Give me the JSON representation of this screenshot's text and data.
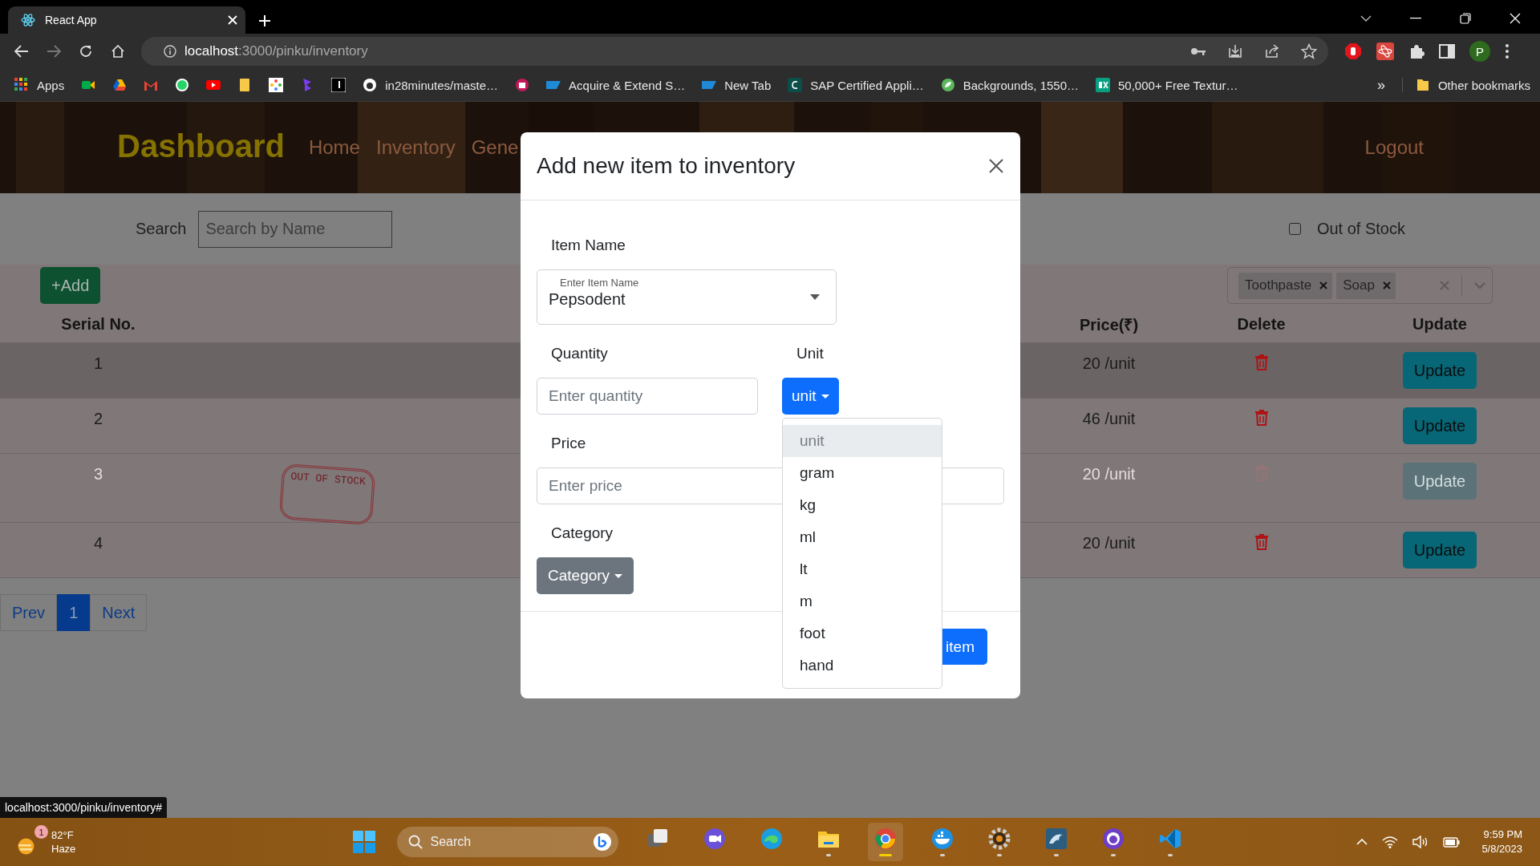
{
  "browser": {
    "tab": {
      "title": "React App"
    },
    "address": {
      "host": "localhost",
      "path": ":3000/pinku/inventory"
    },
    "profile_initial": "P",
    "bookmarks": [
      {
        "kind": "link",
        "label": "Apps"
      },
      {
        "kind": "icon"
      },
      {
        "kind": "icon"
      },
      {
        "kind": "icon"
      },
      {
        "kind": "icon"
      },
      {
        "kind": "icon"
      },
      {
        "kind": "icon"
      },
      {
        "kind": "icon"
      },
      {
        "kind": "icon"
      },
      {
        "kind": "icon"
      },
      {
        "kind": "link",
        "label": "in28minutes/maste…"
      },
      {
        "kind": "icon"
      },
      {
        "kind": "link",
        "label": "Acquire & Extend S…"
      },
      {
        "kind": "link",
        "label": "New Tab"
      },
      {
        "kind": "link",
        "label": "SAP Certified Appli…"
      },
      {
        "kind": "link",
        "label": "Backgrounds, 1550…"
      },
      {
        "kind": "link",
        "label": "50,000+ Free Textur…"
      }
    ],
    "overflow": "»",
    "other_bookmarks": "Other bookmarks"
  },
  "app": {
    "brand": "Dashboard",
    "nav": [
      {
        "label": "Home"
      },
      {
        "label": "Inventory"
      },
      {
        "label": "Gene"
      }
    ],
    "logout": "Logout",
    "search": {
      "label": "Search",
      "placeholder": "Search by Name"
    },
    "out_of_stock_filter": {
      "label": "Out of Stock",
      "checked": false
    },
    "add_button": "+Add",
    "category_filter": {
      "tags": [
        "Toothpaste",
        "Soap"
      ]
    },
    "table": {
      "columns": [
        "Serial No.",
        "Price(₹)",
        "Delete",
        "Update"
      ],
      "rows": [
        {
          "serial": "1",
          "price": "20 /unit",
          "update": "Update",
          "hovered": true,
          "out_of_stock": false
        },
        {
          "serial": "2",
          "price": "46 /unit",
          "update": "Update",
          "hovered": false,
          "out_of_stock": false
        },
        {
          "serial": "3",
          "price": "20 /unit",
          "update": "Update",
          "hovered": false,
          "out_of_stock": true,
          "stamp": "OUT OF STOCK"
        },
        {
          "serial": "4",
          "price": "20 /unit",
          "update": "Update",
          "hovered": false,
          "out_of_stock": false
        }
      ]
    },
    "pagination": {
      "prev": "Prev",
      "pages": [
        {
          "label": "1",
          "selected": true
        }
      ],
      "next": "Next"
    }
  },
  "modal": {
    "title": "Add new item to inventory",
    "item_name": {
      "label": "Item Name",
      "floating_label": "Enter Item Name",
      "value": "Pepsodent"
    },
    "quantity": {
      "label": "Quantity",
      "placeholder": "Enter quantity"
    },
    "unit": {
      "label": "Unit",
      "button": "unit"
    },
    "price": {
      "label": "Price",
      "placeholder": "Enter price"
    },
    "category": {
      "label": "Category",
      "button": "Category"
    },
    "submit": "item",
    "unit_menu": [
      {
        "label": "unit",
        "selected": true
      },
      {
        "label": "gram",
        "selected": false
      },
      {
        "label": "kg",
        "selected": false
      },
      {
        "label": "ml",
        "selected": false
      },
      {
        "label": "lt",
        "selected": false
      },
      {
        "label": "m",
        "selected": false
      },
      {
        "label": "foot",
        "selected": false
      },
      {
        "label": "hand",
        "selected": false
      }
    ]
  },
  "status_url": "localhost:3000/pinku/inventory#",
  "taskbar": {
    "weather": {
      "badge": "1",
      "temperature": "82°F",
      "condition": "Haze"
    },
    "search": {
      "placeholder": "Search"
    },
    "apps": [
      {
        "running": false,
        "active": false
      },
      {
        "running": false,
        "active": false
      },
      {
        "running": false,
        "active": false
      },
      {
        "running": true,
        "active": false
      },
      {
        "running": true,
        "active": true
      },
      {
        "running": true,
        "active": false
      },
      {
        "running": true,
        "active": false
      },
      {
        "running": true,
        "active": false
      },
      {
        "running": true,
        "active": false
      },
      {
        "running": true,
        "active": false
      }
    ],
    "clock": {
      "time": "9:59 PM",
      "date": "5/8/2023"
    }
  }
}
